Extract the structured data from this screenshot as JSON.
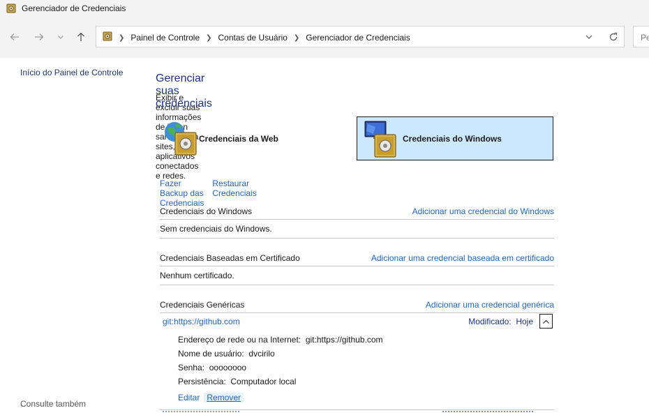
{
  "window": {
    "title": "Gerenciador de Credenciais"
  },
  "navigation": {
    "breadcrumbs": [
      "Painel de Controle",
      "Contas de Usuário",
      "Gerenciador de Credenciais"
    ],
    "search_placeholder": "Pe"
  },
  "sidebar": {
    "home_link": "Início do Painel de Controle",
    "see_also": "Consulte também"
  },
  "main": {
    "heading": "Gerenciar suas credenciais",
    "description": "Exibir e excluir suas informações de logon salvas para sites, aplicativos conectados e redes.",
    "credential_types": [
      {
        "label": "Credenciais da Web",
        "selected": false
      },
      {
        "label": "Credenciais do Windows",
        "selected": true
      }
    ],
    "backup_link": "Fazer Backup das Credenciais",
    "restore_link": "Restaurar Credenciais",
    "sections": {
      "windows": {
        "title": "Credenciais do Windows",
        "add_link": "Adicionar uma credencial do Windows",
        "empty_text": "Sem credenciais do Windows."
      },
      "certificate": {
        "title": "Credenciais Baseadas em Certificado",
        "add_link": "Adicionar uma credencial baseada em certificado",
        "empty_text": "Nenhum certificado."
      },
      "generic": {
        "title": "Credenciais Genéricas",
        "add_link": "Adicionar uma credencial genérica",
        "entry": {
          "name": "git:https://github.com",
          "modified_label": "Modificado:",
          "modified_value": "Hoje",
          "details": [
            {
              "label": "Endereço de rede ou na Internet:",
              "value": "git:https://github.com"
            },
            {
              "label": "Nome de usuário:",
              "value": "dvcirilo"
            },
            {
              "label": "Senha:",
              "value": "oooooooo"
            },
            {
              "label": "Persistência:",
              "value": "Computador local"
            }
          ],
          "edit_label": "Editar",
          "remove_label": "Remover"
        }
      }
    }
  },
  "colors": {
    "selected_bg": "#cce8ff",
    "link": "#1e64c8",
    "heading": "#1e3287"
  }
}
